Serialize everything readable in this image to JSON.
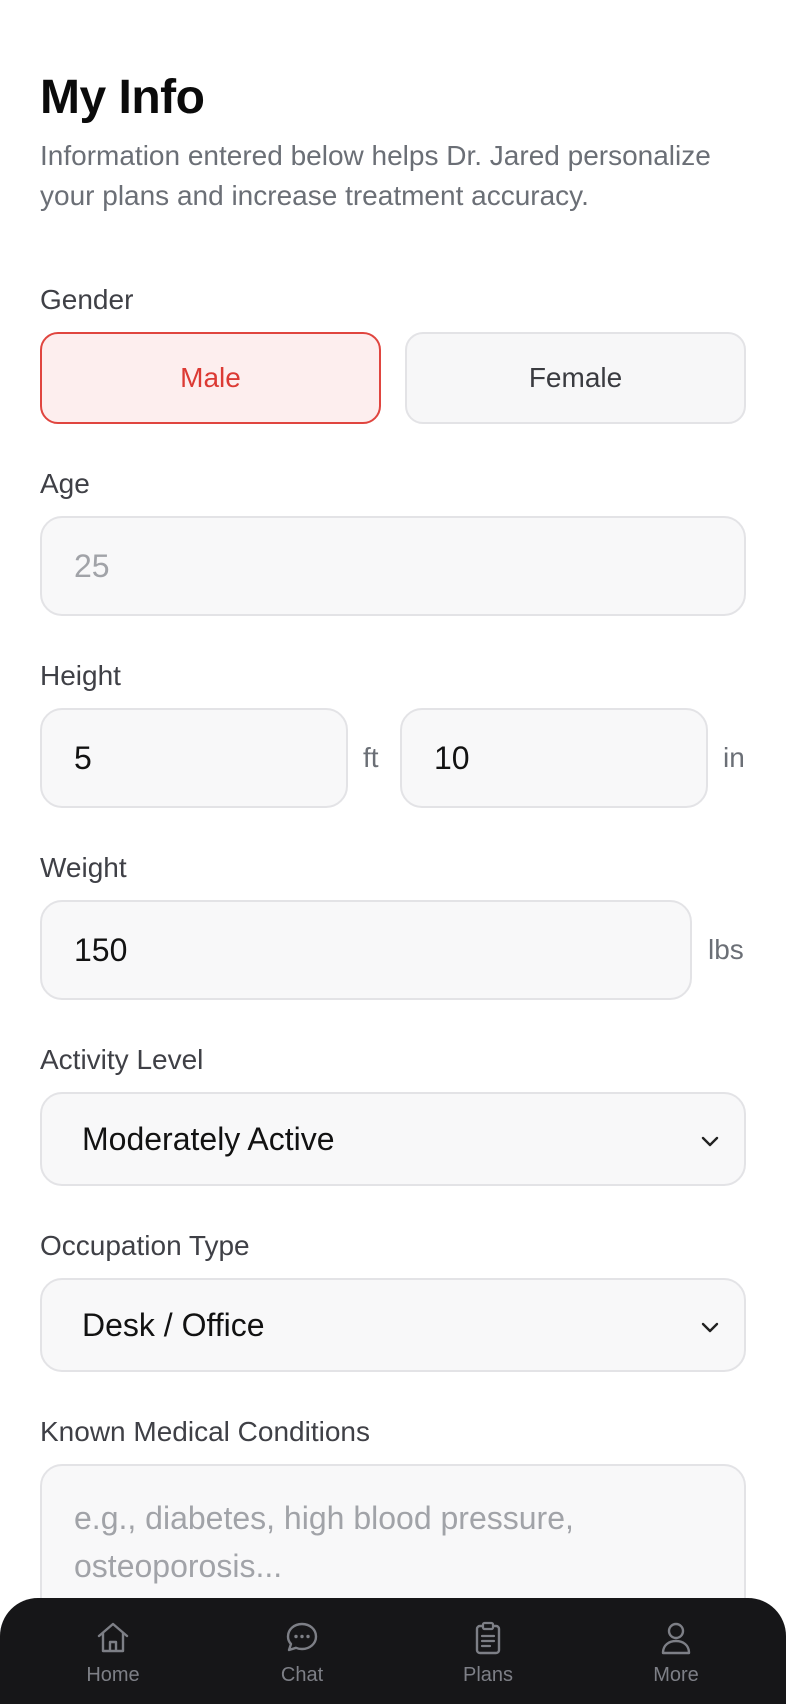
{
  "header": {
    "title": "My Info",
    "subtitle": "Information entered below helps Dr. Jared personalize your plans and increase treatment accuracy."
  },
  "gender": {
    "label": "Gender",
    "options": [
      "Male",
      "Female"
    ],
    "selected": "Male"
  },
  "age": {
    "label": "Age",
    "value": "",
    "placeholder": "25"
  },
  "height": {
    "label": "Height",
    "feet_value": "5",
    "feet_unit": "ft",
    "inches_value": "10",
    "inches_unit": "in"
  },
  "weight": {
    "label": "Weight",
    "value": "150",
    "unit": "lbs"
  },
  "activity": {
    "label": "Activity Level",
    "selected": "Moderately Active"
  },
  "occupation": {
    "label": "Occupation Type",
    "selected": "Desk / Office"
  },
  "conditions": {
    "label": "Known Medical Conditions",
    "value": "",
    "placeholder": "e.g., diabetes, high blood pressure, osteoporosis..."
  },
  "tabbar": {
    "items": [
      {
        "label": "Home",
        "icon": "home-icon"
      },
      {
        "label": "Chat",
        "icon": "chat-icon"
      },
      {
        "label": "Plans",
        "icon": "clipboard-icon"
      },
      {
        "label": "More",
        "icon": "person-icon"
      }
    ]
  },
  "colors": {
    "accent": "#dc3a34",
    "accent_bg": "#fdeeee",
    "field_bg": "#f8f8f9",
    "tabbar_bg": "#161618",
    "tab_inactive": "#7d7f86"
  }
}
